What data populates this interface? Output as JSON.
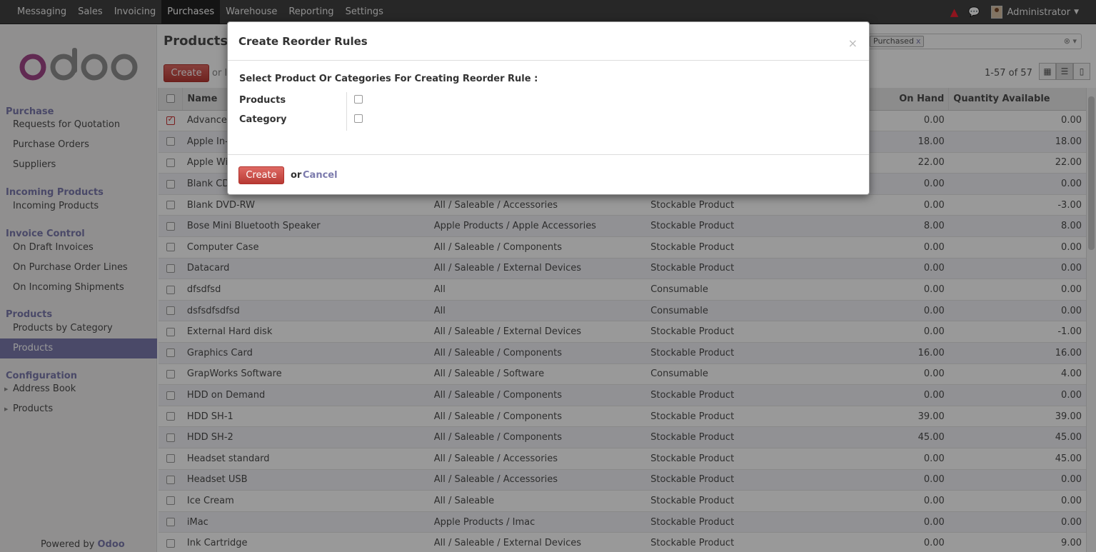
{
  "topbar": {
    "menus": [
      "Messaging",
      "Sales",
      "Invoicing",
      "Purchases",
      "Warehouse",
      "Reporting",
      "Settings"
    ],
    "active_menu": "Purchases",
    "user": "Administrator"
  },
  "sidebar": {
    "logo": "odoo",
    "sections": [
      {
        "title": "Purchase",
        "items": [
          "Requests for Quotation",
          "Purchase Orders",
          "Suppliers"
        ]
      },
      {
        "title": "Incoming Products",
        "items": [
          "Incoming Products"
        ]
      },
      {
        "title": "Invoice Control",
        "items": [
          "On Draft Invoices",
          "On Purchase Order Lines",
          "On Incoming Shipments"
        ]
      },
      {
        "title": "Products",
        "items": [
          "Products by Category",
          "Products"
        ]
      },
      {
        "title": "Configuration",
        "items": [
          "Address Book",
          "Products"
        ]
      }
    ],
    "active_item": "Products",
    "powered_by": "Powered by",
    "powered_brand": "Odoo"
  },
  "main": {
    "title": "Products",
    "create_label": "Create",
    "or_label": "or I",
    "pager": "1-57 of 57",
    "search_facet": "Purchased",
    "search_facet_remove": "x",
    "columns": {
      "name": "Name",
      "on_hand": "On Hand",
      "available": "Quantity Available"
    },
    "rows": [
      {
        "name": "Advance",
        "category": "",
        "type": "",
        "on_hand": "0.00",
        "available": "0.00",
        "checked": true
      },
      {
        "name": "Apple In-E",
        "category": "",
        "type": "",
        "on_hand": "18.00",
        "available": "18.00"
      },
      {
        "name": "Apple Wir",
        "category": "",
        "type": "",
        "on_hand": "22.00",
        "available": "22.00"
      },
      {
        "name": "Blank CD",
        "category": "",
        "type": "",
        "on_hand": "0.00",
        "available": "0.00"
      },
      {
        "name": "Blank DVD-RW",
        "category": "All / Saleable / Accessories",
        "type": "Stockable Product",
        "on_hand": "0.00",
        "available": "-3.00"
      },
      {
        "name": "Bose Mini Bluetooth Speaker",
        "category": "Apple Products / Apple Accessories",
        "type": "Stockable Product",
        "on_hand": "8.00",
        "available": "8.00"
      },
      {
        "name": "Computer Case",
        "category": "All / Saleable / Components",
        "type": "Stockable Product",
        "on_hand": "0.00",
        "available": "0.00"
      },
      {
        "name": "Datacard",
        "category": "All / Saleable / External Devices",
        "type": "Stockable Product",
        "on_hand": "0.00",
        "available": "0.00"
      },
      {
        "name": "dfsdfsd",
        "category": "All",
        "type": "Consumable",
        "on_hand": "0.00",
        "available": "0.00"
      },
      {
        "name": "dsfsdfsdfsd",
        "category": "All",
        "type": "Consumable",
        "on_hand": "0.00",
        "available": "0.00"
      },
      {
        "name": "External Hard disk",
        "category": "All / Saleable / External Devices",
        "type": "Stockable Product",
        "on_hand": "0.00",
        "available": "-1.00"
      },
      {
        "name": "Graphics Card",
        "category": "All / Saleable / Components",
        "type": "Stockable Product",
        "on_hand": "16.00",
        "available": "16.00"
      },
      {
        "name": "GrapWorks Software",
        "category": "All / Saleable / Software",
        "type": "Consumable",
        "on_hand": "0.00",
        "available": "4.00"
      },
      {
        "name": "HDD on Demand",
        "category": "All / Saleable / Components",
        "type": "Stockable Product",
        "on_hand": "0.00",
        "available": "0.00"
      },
      {
        "name": "HDD SH-1",
        "category": "All / Saleable / Components",
        "type": "Stockable Product",
        "on_hand": "39.00",
        "available": "39.00"
      },
      {
        "name": "HDD SH-2",
        "category": "All / Saleable / Components",
        "type": "Stockable Product",
        "on_hand": "45.00",
        "available": "45.00"
      },
      {
        "name": "Headset standard",
        "category": "All / Saleable / Accessories",
        "type": "Stockable Product",
        "on_hand": "0.00",
        "available": "45.00"
      },
      {
        "name": "Headset USB",
        "category": "All / Saleable / Accessories",
        "type": "Stockable Product",
        "on_hand": "0.00",
        "available": "0.00"
      },
      {
        "name": "Ice Cream",
        "category": "All / Saleable",
        "type": "Stockable Product",
        "on_hand": "0.00",
        "available": "0.00"
      },
      {
        "name": "iMac",
        "category": "Apple Products / Imac",
        "type": "Stockable Product",
        "on_hand": "0.00",
        "available": "0.00"
      },
      {
        "name": "Ink Cartridge",
        "category": "All / Saleable / External Devices",
        "type": "Stockable Product",
        "on_hand": "0.00",
        "available": "9.00"
      }
    ]
  },
  "modal": {
    "title": "Create Reorder Rules",
    "close": "×",
    "prompt": "Select Product Or Categories For Creating Reorder Rule :",
    "fields": [
      {
        "label": "Products",
        "checked": false
      },
      {
        "label": "Category",
        "checked": false
      }
    ],
    "create_label": "Create",
    "or_label": "or",
    "cancel_label": "Cancel"
  },
  "colors": {
    "accent": "#7c7bad",
    "button_red": "#c9302c",
    "topbar": "#414141"
  }
}
